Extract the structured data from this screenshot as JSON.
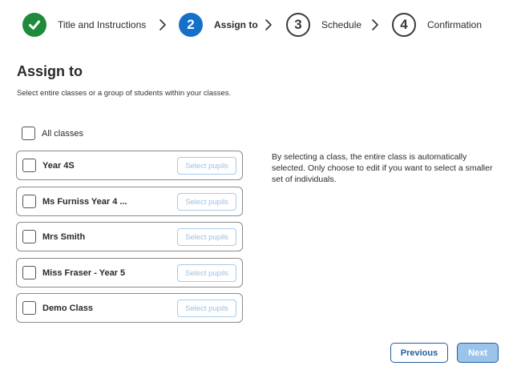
{
  "stepper": {
    "steps": [
      {
        "number": "",
        "label": "Title and Instructions",
        "state": "done",
        "icon": "check-icon"
      },
      {
        "number": "2",
        "label": "Assign to",
        "state": "active"
      },
      {
        "number": "3",
        "label": "Schedule",
        "state": "todo"
      },
      {
        "number": "4",
        "label": "Confirmation",
        "state": "todo"
      }
    ]
  },
  "page": {
    "title": "Assign to",
    "subtitle": "Select entire classes or a group of students within your classes.",
    "all_classes_label": "All classes",
    "info_text": "By selecting a class, the entire class is automatically selected. Only choose to edit if you want to select a smaller set of individuals."
  },
  "classes": [
    {
      "name": "Year 4S",
      "action_label": "Select pupils",
      "checked": false
    },
    {
      "name": "Ms Furniss Year 4 ...",
      "action_label": "Select pupils",
      "checked": false
    },
    {
      "name": "Mrs Smith",
      "action_label": "Select pupils",
      "checked": false
    },
    {
      "name": "Miss Fraser - Year 5",
      "action_label": "Select pupils",
      "checked": false
    },
    {
      "name": "Demo Class",
      "action_label": "Select pupils",
      "checked": false
    }
  ],
  "footer": {
    "previous_label": "Previous",
    "next_label": "Next"
  },
  "colors": {
    "done": "#1e8a3b",
    "active": "#1570c8",
    "primary_border": "#1f5f9e",
    "next_disabled_bg": "#9cc3ea"
  }
}
